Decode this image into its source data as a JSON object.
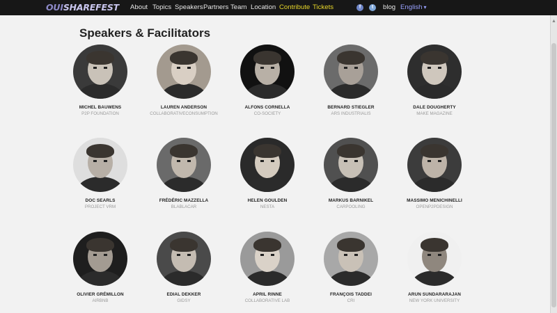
{
  "header": {
    "logo_part1": "OUI",
    "logo_part2": "SHARE",
    "logo_part3": "FEST",
    "nav": [
      {
        "label": "About",
        "highlight": false
      },
      {
        "label": "Topics",
        "highlight": false
      },
      {
        "label": "Speakers",
        "highlight": false
      },
      {
        "label": "Partners",
        "highlight": false
      },
      {
        "label": "Team",
        "highlight": false
      },
      {
        "label": "Location",
        "highlight": false
      },
      {
        "label": "Contribute",
        "highlight": true
      },
      {
        "label": "Tickets",
        "highlight": true
      }
    ],
    "facebook_icon": "f",
    "twitter_icon": "t",
    "blog_label": "blog",
    "language_label": "English",
    "language_caret": "▾"
  },
  "page": {
    "title": "Speakers & Facilitators"
  },
  "speakers": [
    {
      "name": "Michel Bauwens",
      "org": "P2P Foundation",
      "tone": "#3a3a3a",
      "skin": "#c9c2b8"
    },
    {
      "name": "Lauren Anderson",
      "org": "CollaborativeConsumption",
      "tone": "#a39a8f",
      "skin": "#d9cfc4"
    },
    {
      "name": "Alfons Cornella",
      "org": "Co-Society",
      "tone": "#111111",
      "skin": "#b8b0a6"
    },
    {
      "name": "Bernard Stiegler",
      "org": "Ars Industrialis",
      "tone": "#6b6b6b",
      "skin": "#a8a098"
    },
    {
      "name": "Dale Dougherty",
      "org": "Make Magazine",
      "tone": "#2e2e2e",
      "skin": "#cfc7bd"
    },
    {
      "name": "Doc Searls",
      "org": "Project VRM",
      "tone": "#dedede",
      "skin": "#b7afa6"
    },
    {
      "name": "Frédéric Mazzella",
      "org": "BlaBlaCar",
      "tone": "#6a6a6a",
      "skin": "#c1b8ad"
    },
    {
      "name": "Helen Goulden",
      "org": "Nesta",
      "tone": "#2a2a2a",
      "skin": "#d4cbbf"
    },
    {
      "name": "Markus Barnikel",
      "org": "Carpooling",
      "tone": "#505050",
      "skin": "#c7c0b6"
    },
    {
      "name": "Massimo Menichinelli",
      "org": "OpenP2PDesign",
      "tone": "#3c3c3c",
      "skin": "#bdb3a8"
    },
    {
      "name": "Olivier Grémillon",
      "org": "Airbnb",
      "tone": "#1e1e1e",
      "skin": "#a39b92"
    },
    {
      "name": "Edial Dekker",
      "org": "Gidsy",
      "tone": "#4a4a4a",
      "skin": "#c4bcb2"
    },
    {
      "name": "April Rinne",
      "org": "Collaborative Lab",
      "tone": "#9a9a9a",
      "skin": "#dad2c8"
    },
    {
      "name": "François Taddei",
      "org": "CRI",
      "tone": "#a8a8a8",
      "skin": "#c9c1b7"
    },
    {
      "name": "Arun Sundararajan",
      "org": "New York University",
      "tone": "#f0f0f0",
      "skin": "#8f877e"
    }
  ],
  "colors": {
    "topbar": "#171717",
    "highlight": "#e8d72a",
    "language": "#9aa2ff",
    "background": "#f2f2f2"
  }
}
